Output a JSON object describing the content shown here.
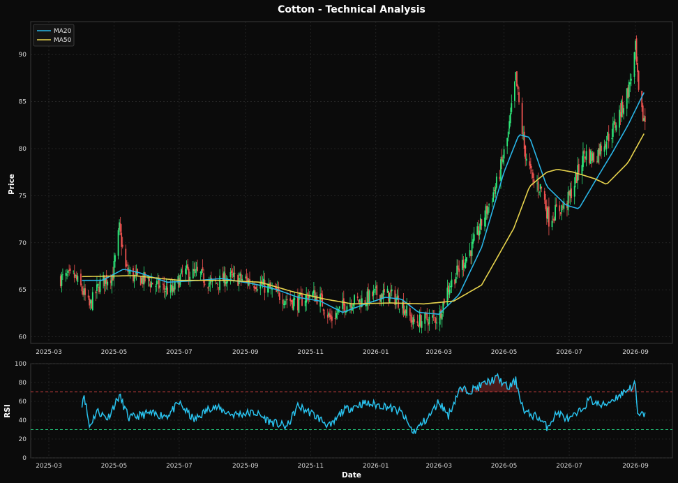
{
  "chart_data": [
    {
      "type": "candlestick",
      "title": "Cotton - Technical Analysis",
      "xlabel": "",
      "ylabel": "Price",
      "ylim": [
        59.3,
        93.5
      ],
      "yticks": [
        60,
        65,
        70,
        75,
        80,
        85,
        90
      ],
      "xticks": [
        "2025-03",
        "2025-05",
        "2025-07",
        "2025-09",
        "2025-11",
        "2026-01",
        "2026-03",
        "2026-05",
        "2026-07",
        "2026-09"
      ],
      "grid": true,
      "legend": {
        "position": "top-left",
        "entries": [
          "MA20",
          "MA50"
        ]
      },
      "colors": {
        "up": "#2ee87a",
        "down": "#ef5350",
        "ma20": "#29b6e8",
        "ma50": "#e8d44d",
        "background": "#0b0b0b"
      },
      "close_anchors": [
        [
          "2025-03-12",
          66.2
        ],
        [
          "2025-03-25",
          66.4
        ],
        [
          "2025-04-01",
          65.0
        ],
        [
          "2025-04-08",
          63.2
        ],
        [
          "2025-04-18",
          65.7
        ],
        [
          "2025-04-30",
          66.6
        ],
        [
          "2025-05-06",
          71.5
        ],
        [
          "2025-05-12",
          67.2
        ],
        [
          "2025-05-20",
          66.3
        ],
        [
          "2025-06-01",
          66.0
        ],
        [
          "2025-06-15",
          65.2
        ],
        [
          "2025-06-25",
          64.8
        ],
        [
          "2025-07-05",
          66.9
        ],
        [
          "2025-07-20",
          66.6
        ],
        [
          "2025-08-01",
          65.5
        ],
        [
          "2025-08-15",
          66.3
        ],
        [
          "2025-08-30",
          66.1
        ],
        [
          "2025-09-15",
          65.6
        ],
        [
          "2025-10-01",
          64.5
        ],
        [
          "2025-10-10",
          64.0
        ],
        [
          "2025-10-20",
          63.6
        ],
        [
          "2025-11-01",
          64.6
        ],
        [
          "2025-11-10",
          64.0
        ],
        [
          "2025-11-20",
          61.8
        ],
        [
          "2025-12-01",
          63.2
        ],
        [
          "2025-12-10",
          63.8
        ],
        [
          "2025-12-20",
          63.8
        ],
        [
          "2026-01-01",
          64.6
        ],
        [
          "2026-01-15",
          64.4
        ],
        [
          "2026-01-25",
          63.6
        ],
        [
          "2026-02-05",
          61.5
        ],
        [
          "2026-02-15",
          61.8
        ],
        [
          "2026-03-01",
          62.0
        ],
        [
          "2026-03-08",
          64.8
        ],
        [
          "2026-03-20",
          67.2
        ],
        [
          "2026-04-01",
          69.5
        ],
        [
          "2026-04-15",
          73.5
        ],
        [
          "2026-04-25",
          76.5
        ],
        [
          "2026-05-05",
          81.5
        ],
        [
          "2026-05-12",
          87.5
        ],
        [
          "2026-05-20",
          80.0
        ],
        [
          "2026-05-28",
          76.5
        ],
        [
          "2026-06-05",
          75.8
        ],
        [
          "2026-06-12",
          72.5
        ],
        [
          "2026-06-20",
          73.5
        ],
        [
          "2026-06-28",
          74.0
        ],
        [
          "2026-07-05",
          76.0
        ],
        [
          "2026-07-15",
          79.5
        ],
        [
          "2026-07-25",
          79.0
        ],
        [
          "2026-08-01",
          80.5
        ],
        [
          "2026-08-10",
          81.8
        ],
        [
          "2026-08-20",
          84.5
        ],
        [
          "2026-08-26",
          86.5
        ],
        [
          "2026-09-01",
          90.5
        ],
        [
          "2026-09-05",
          84.0
        ],
        [
          "2026-09-10",
          83.0
        ]
      ],
      "ma20_anchors": [
        [
          "2025-04-01",
          66.0
        ],
        [
          "2025-04-20",
          66.0
        ],
        [
          "2025-05-10",
          67.2
        ],
        [
          "2025-05-25",
          66.8
        ],
        [
          "2025-06-20",
          65.8
        ],
        [
          "2025-07-20",
          66.0
        ],
        [
          "2025-08-10",
          66.2
        ],
        [
          "2025-09-10",
          65.6
        ],
        [
          "2025-10-01",
          65.0
        ],
        [
          "2025-10-20",
          64.2
        ],
        [
          "2025-11-10",
          63.8
        ],
        [
          "2025-12-01",
          62.6
        ],
        [
          "2025-12-20",
          63.4
        ],
        [
          "2026-01-10",
          64.2
        ],
        [
          "2026-01-25",
          64.0
        ],
        [
          "2026-02-10",
          62.6
        ],
        [
          "2026-03-01",
          62.4
        ],
        [
          "2026-03-20",
          64.5
        ],
        [
          "2026-04-10",
          69.5
        ],
        [
          "2026-05-01",
          77.5
        ],
        [
          "2026-05-15",
          81.5
        ],
        [
          "2026-05-25",
          81.2
        ],
        [
          "2026-06-10",
          76.0
        ],
        [
          "2026-06-28",
          74.0
        ],
        [
          "2026-07-10",
          73.6
        ],
        [
          "2026-07-25",
          76.5
        ],
        [
          "2026-08-10",
          79.5
        ],
        [
          "2026-08-25",
          82.5
        ],
        [
          "2026-09-10",
          86.2
        ]
      ],
      "ma50_anchors": [
        [
          "2025-04-01",
          66.4
        ],
        [
          "2025-05-20",
          66.5
        ],
        [
          "2025-07-01",
          66.0
        ],
        [
          "2025-08-15",
          66.0
        ],
        [
          "2025-09-15",
          65.8
        ],
        [
          "2025-10-15",
          64.8
        ],
        [
          "2025-11-15",
          64.0
        ],
        [
          "2025-12-10",
          63.5
        ],
        [
          "2026-01-15",
          63.6
        ],
        [
          "2026-02-15",
          63.5
        ],
        [
          "2026-03-15",
          63.8
        ],
        [
          "2026-04-10",
          65.5
        ],
        [
          "2026-04-25",
          68.5
        ],
        [
          "2026-05-10",
          71.5
        ],
        [
          "2026-05-25",
          76.0
        ],
        [
          "2026-06-10",
          77.5
        ],
        [
          "2026-06-20",
          77.8
        ],
        [
          "2026-07-05",
          77.5
        ],
        [
          "2026-07-25",
          76.8
        ],
        [
          "2026-08-05",
          76.2
        ],
        [
          "2026-08-25",
          78.5
        ],
        [
          "2026-09-10",
          81.8
        ]
      ]
    },
    {
      "type": "line",
      "xlabel": "Date",
      "ylabel": "RSI",
      "ylim": [
        0,
        100
      ],
      "yticks": [
        0,
        20,
        40,
        60,
        80,
        100
      ],
      "xticks": [
        "2025-03",
        "2025-05",
        "2025-07",
        "2025-09",
        "2025-11",
        "2026-01",
        "2026-03",
        "2026-05",
        "2026-07",
        "2026-09"
      ],
      "reference_lines": {
        "overbought": 70,
        "oversold": 30
      },
      "grid": true,
      "colors": {
        "rsi": "#29c3ef",
        "overbought": "#d84040",
        "oversold": "#22c47a"
      },
      "rsi_anchors": [
        [
          "2025-04-01",
          58
        ],
        [
          "2025-04-03",
          68
        ],
        [
          "2025-04-08",
          33
        ],
        [
          "2025-04-15",
          50
        ],
        [
          "2025-04-25",
          42
        ],
        [
          "2025-05-06",
          66
        ],
        [
          "2025-05-15",
          42
        ],
        [
          "2025-06-01",
          47
        ],
        [
          "2025-06-20",
          45
        ],
        [
          "2025-07-01",
          58
        ],
        [
          "2025-07-15",
          40
        ],
        [
          "2025-08-01",
          55
        ],
        [
          "2025-08-20",
          46
        ],
        [
          "2025-09-10",
          48
        ],
        [
          "2025-09-25",
          38
        ],
        [
          "2025-10-10",
          33
        ],
        [
          "2025-10-20",
          55
        ],
        [
          "2025-11-01",
          48
        ],
        [
          "2025-11-20",
          33
        ],
        [
          "2025-12-01",
          50
        ],
        [
          "2025-12-20",
          58
        ],
        [
          "2026-01-10",
          55
        ],
        [
          "2026-01-25",
          48
        ],
        [
          "2026-02-05",
          27
        ],
        [
          "2026-02-20",
          44
        ],
        [
          "2026-03-01",
          60
        ],
        [
          "2026-03-10",
          45
        ],
        [
          "2026-03-20",
          72
        ],
        [
          "2026-04-01",
          72
        ],
        [
          "2026-04-15",
          80
        ],
        [
          "2026-04-25",
          85
        ],
        [
          "2026-05-05",
          74
        ],
        [
          "2026-05-12",
          82
        ],
        [
          "2026-05-20",
          48
        ],
        [
          "2026-06-01",
          44
        ],
        [
          "2026-06-10",
          33
        ],
        [
          "2026-06-20",
          48
        ],
        [
          "2026-07-01",
          40
        ],
        [
          "2026-07-10",
          48
        ],
        [
          "2026-07-20",
          62
        ],
        [
          "2026-08-01",
          55
        ],
        [
          "2026-08-15",
          65
        ],
        [
          "2026-08-25",
          73
        ],
        [
          "2026-09-01",
          78
        ],
        [
          "2026-09-03",
          44
        ],
        [
          "2026-09-10",
          47
        ]
      ]
    }
  ]
}
